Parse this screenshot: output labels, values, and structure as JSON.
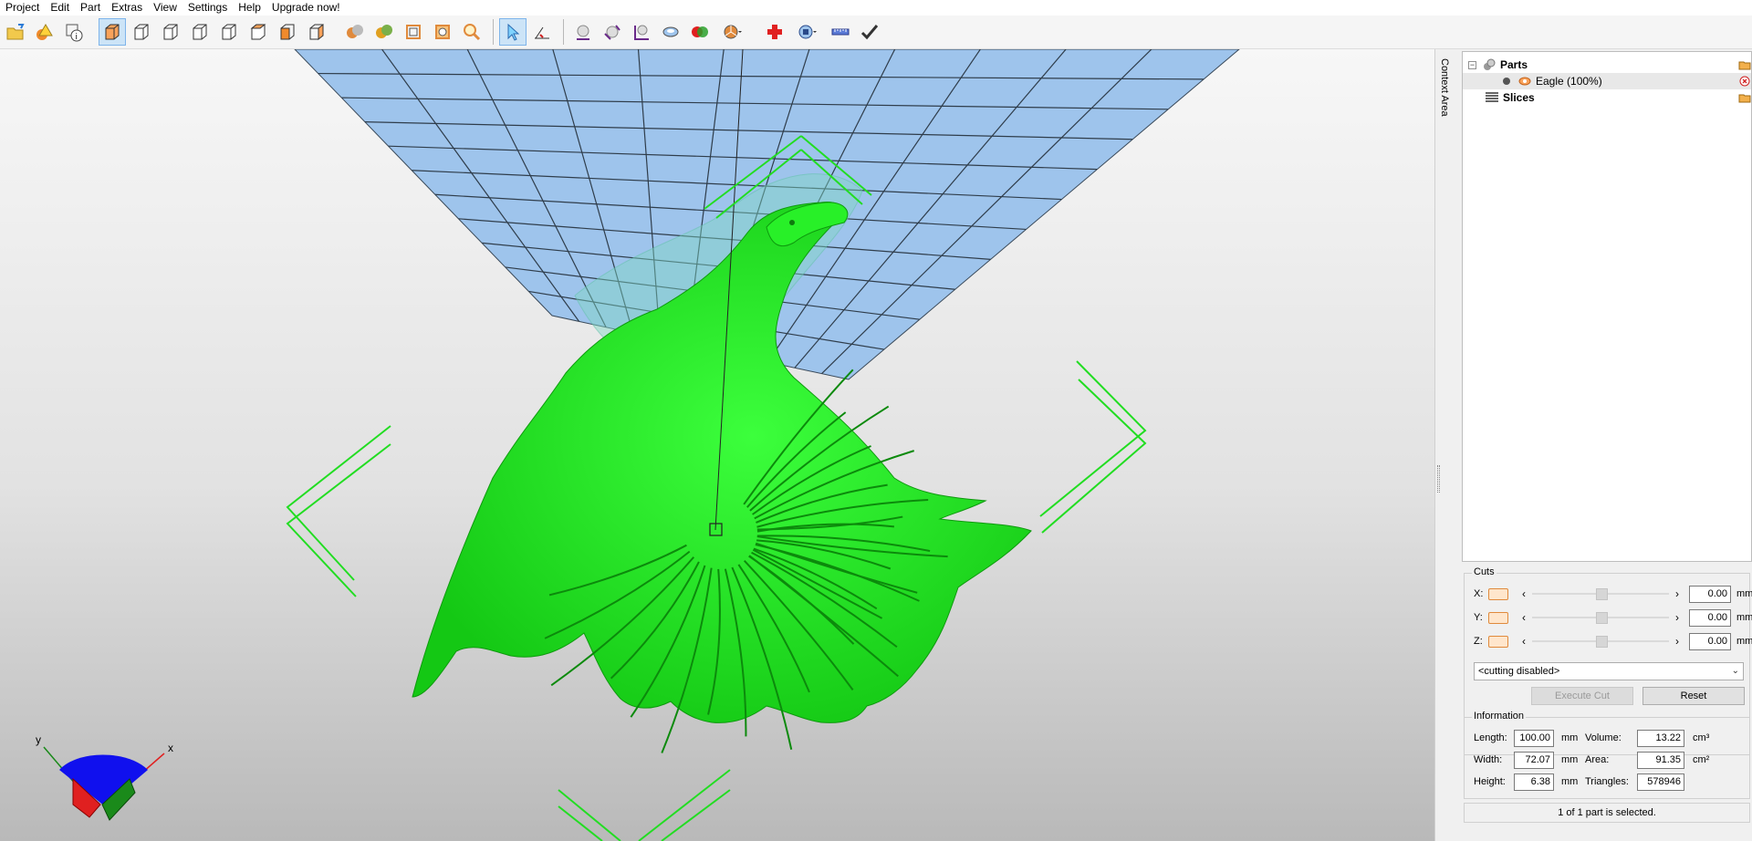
{
  "menu": [
    "Project",
    "Edit",
    "Part",
    "Extras",
    "View",
    "Settings",
    "Help",
    "Upgrade now!"
  ],
  "toolbar_icons": [
    "open-file-icon",
    "add-parts-icon",
    "part-info-icon",
    "view-perspective-icon",
    "view-front-icon",
    "view-back-icon",
    "view-left-icon",
    "view-right-icon",
    "view-top-icon",
    "view-bottom-icon",
    "shaded-icon",
    "shaded-wireframe-icon",
    "wireframe-icon",
    "transparent-icon",
    "zoom-icon",
    "select-icon",
    "measure-icon",
    "move-icon",
    "rotate-icon",
    "scale-icon",
    "hollow-icon",
    "boolean-icon",
    "pie-menu-icon",
    "repair-icon",
    "analyse-icon",
    "ruler-icon",
    "apply-icon"
  ],
  "context_area_label": "Context Area",
  "tree": {
    "parts_label": "Parts",
    "part_name": "Eagle (100%)",
    "slices_label": "Slices"
  },
  "cuts": {
    "title": "Cuts",
    "axes": [
      {
        "label": "X:",
        "value": "0.00",
        "unit": "mm"
      },
      {
        "label": "Y:",
        "value": "0.00",
        "unit": "mm"
      },
      {
        "label": "Z:",
        "value": "0.00",
        "unit": "mm"
      }
    ],
    "mode": "<cutting disabled>",
    "execute_label": "Execute Cut",
    "reset_label": "Reset"
  },
  "information": {
    "title": "Information",
    "length_label": "Length:",
    "length_value": "100.00",
    "length_unit": "mm",
    "width_label": "Width:",
    "width_value": "72.07",
    "width_unit": "mm",
    "height_label": "Height:",
    "height_value": "6.38",
    "height_unit": "mm",
    "volume_label": "Volume:",
    "volume_value": "13.22",
    "volume_unit": "cm³",
    "area_label": "Area:",
    "area_value": "91.35",
    "area_unit": "cm²",
    "triangles_label": "Triangles:",
    "triangles_value": "578946"
  },
  "status": "1 of 1 part is selected.",
  "axis_labels": {
    "x": "x",
    "y": "y"
  },
  "colors": {
    "model": "#1ee81e",
    "build_plate": "#9ec4ec",
    "selection_bracket": "#22dd22",
    "axis_x": "#e02020",
    "axis_y": "#1a8a1a",
    "axis_z": "#1010ee"
  }
}
